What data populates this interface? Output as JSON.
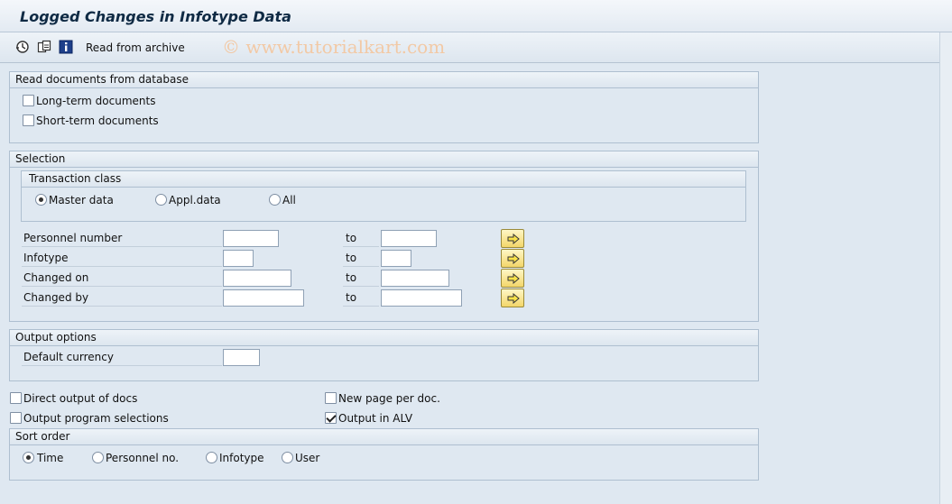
{
  "app": {
    "title": "Logged Changes in Infotype Data"
  },
  "toolbar": {
    "execute_icon": "clock-execute-icon",
    "variant_icon": "get-variant-icon",
    "info_icon": "info-icon",
    "read_archive_label": "Read from archive"
  },
  "watermark": "© www.tutorialkart.com",
  "read_docs": {
    "title": "Read documents from database",
    "long_term": {
      "label": "Long-term documents",
      "checked": false
    },
    "short_term": {
      "label": "Short-term documents",
      "checked": false
    }
  },
  "selection": {
    "title": "Selection",
    "transaction_class": {
      "title": "Transaction class",
      "options": [
        "Master data",
        "Appl.data",
        "All"
      ],
      "selected": "Master data"
    },
    "fields": [
      {
        "label": "Personnel number",
        "low": "",
        "high": "",
        "to": "to"
      },
      {
        "label": "Infotype",
        "low": "",
        "high": "",
        "to": "to"
      },
      {
        "label": "Changed on",
        "low": "",
        "high": "",
        "to": "to"
      },
      {
        "label": "Changed by",
        "low": "",
        "high": "",
        "to": "to"
      }
    ]
  },
  "output_options": {
    "title": "Output options",
    "default_currency_label": "Default currency",
    "default_currency_value": ""
  },
  "checkboxes": {
    "direct_output": {
      "label": "Direct output of docs",
      "checked": false
    },
    "output_program_selections": {
      "label": "Output program selections",
      "checked": false
    },
    "new_page": {
      "label": "New page per doc.",
      "checked": false
    },
    "output_alv": {
      "label": "Output in ALV",
      "checked": true
    }
  },
  "sort_order": {
    "title": "Sort order",
    "options": [
      "Time",
      "Personnel no.",
      "Infotype",
      "User"
    ],
    "selected": "Time"
  }
}
